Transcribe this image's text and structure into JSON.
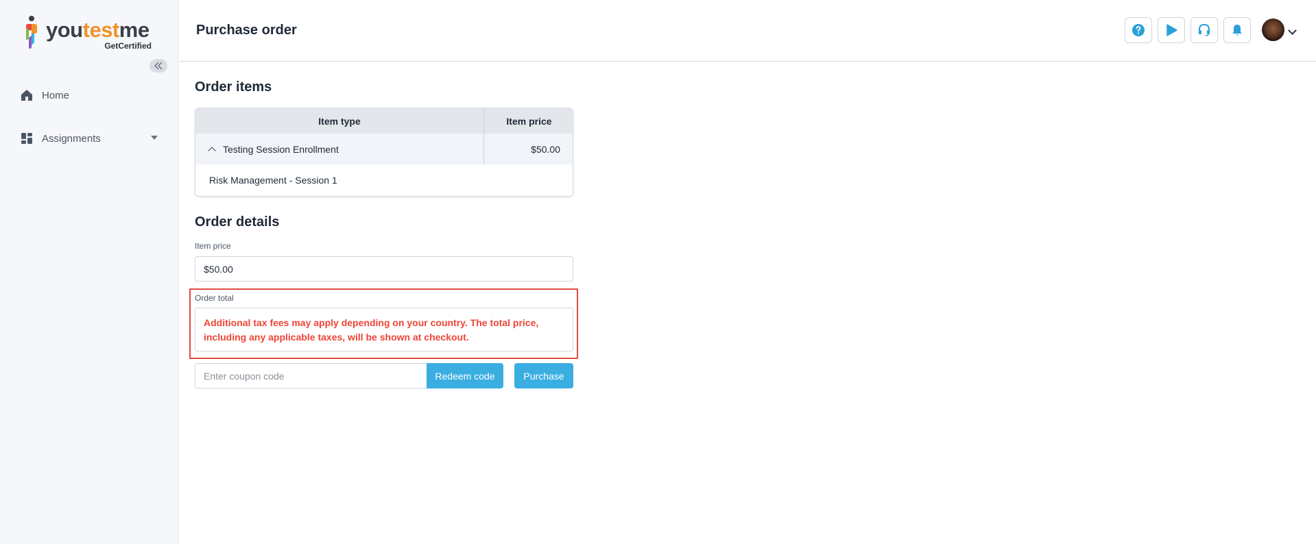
{
  "brand": {
    "name_part1": "you",
    "name_part2": "test",
    "name_part3": "me",
    "subtitle": "GetCertified",
    "accent_color": "#3aaee1",
    "warning_color": "#ef4435"
  },
  "sidebar": {
    "collapse_icon": "double-chevron-left-icon",
    "items": [
      {
        "label": "Home",
        "icon": "home-icon"
      },
      {
        "label": "Assignments",
        "icon": "dashboard-icon",
        "has_caret": true
      }
    ]
  },
  "header": {
    "title": "Purchase order",
    "buttons": [
      {
        "icon": "help-icon"
      },
      {
        "icon": "play-icon"
      },
      {
        "icon": "headset-icon"
      },
      {
        "icon": "bell-icon"
      }
    ],
    "avatar_icon": "user-avatar"
  },
  "order_items": {
    "title": "Order items",
    "columns": [
      "Item type",
      "Item price"
    ],
    "rows": [
      {
        "type": "Testing Session Enrollment",
        "price": "$50.00",
        "expanded": true,
        "detail": "Risk Management - Session 1"
      }
    ]
  },
  "order_details": {
    "title": "Order details",
    "item_price_label": "Item price",
    "item_price_value": "$50.00",
    "order_total_label": "Order total",
    "order_total_notice": "Additional tax fees may apply depending on your country. The total price, including any applicable taxes, will be shown at checkout.",
    "coupon_placeholder": "Enter coupon code",
    "coupon_value": "",
    "redeem_label": "Redeem code",
    "purchase_label": "Purchase"
  }
}
